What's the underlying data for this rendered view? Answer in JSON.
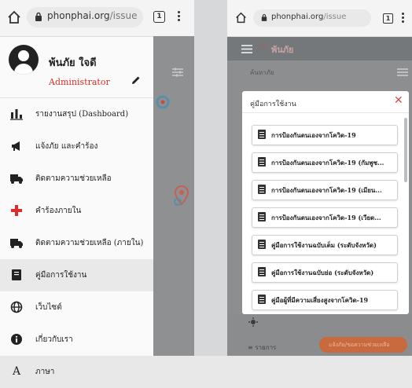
{
  "left": {
    "url": {
      "domain": "phonphai.org",
      "path": "/issue"
    },
    "tab_count": "1",
    "profile": {
      "name": "พ้นภัย ใจดี",
      "role": "Administrator"
    },
    "menu": [
      {
        "icon": "bar-chart-icon",
        "label": "รายงานสรุป (Dashboard)"
      },
      {
        "icon": "megaphone-icon",
        "label": "แจ้งภัย และคำร้อง"
      },
      {
        "icon": "truck-icon",
        "label": "ติดตามความช่วยเหลือ"
      },
      {
        "icon": "red-cross-icon",
        "label": "คำร้องภายใน"
      },
      {
        "icon": "truck-icon",
        "label": "ติดตามความช่วยเหลือ (ภายใน)"
      },
      {
        "icon": "book-icon",
        "label": "คู่มือการใช้งาน"
      },
      {
        "icon": "globe-icon",
        "label": "เว็บไซต์"
      },
      {
        "icon": "info-icon",
        "label": "เกี่ยวกับเรา"
      },
      {
        "icon": "translate-icon",
        "label": "ภาษา"
      }
    ],
    "active_index": 5
  },
  "right": {
    "url": {
      "domain": "phonphai.org",
      "path": "/issue"
    },
    "tab_count": "1",
    "brand": "พ้นภัย",
    "search_placeholder": "ค้นหาภัย",
    "modal": {
      "title": "คู่มือการใช้งาน",
      "items": [
        "การป้องกันตนเองจากโควิด-19",
        "การป้องกันตนเองจากโควิด-19 (กัมพูช...",
        "การป้องกันตนเองจากโควิด-19 (เมียน...",
        "การป้องกันตนเองจากโควิด-19 (เวียด...",
        "คู่มือการใช้งานฉบับเต็ม (ระดับจังหวัด)",
        "คู่มือการใช้งานฉบับย่อ (ระดับจังหวัด)",
        "คู่มือผู้ที่มีความเสี่ยงสูงจากโควิด-19"
      ]
    },
    "list_label": "≡ รายการ",
    "action_label": "แจ้งภัย/ขอความช่วยเหลือ"
  },
  "colors": {
    "accent_red": "#d0312d",
    "brand_heart": "#c84c40",
    "action_orange": "#c96a3e"
  }
}
